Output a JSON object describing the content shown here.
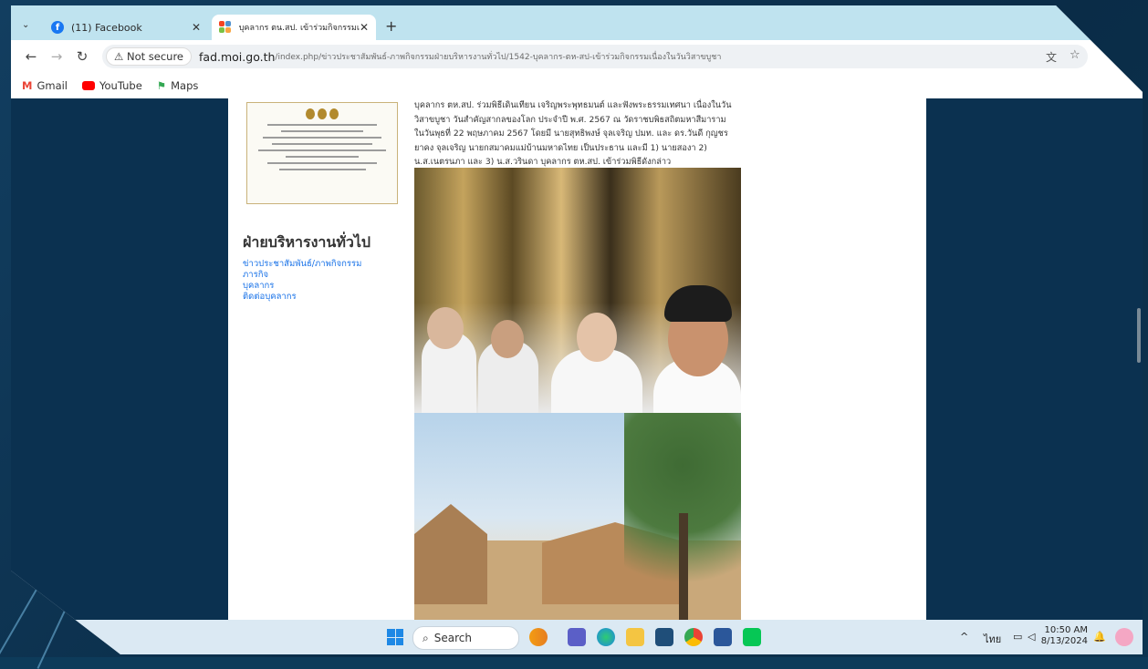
{
  "tabs": [
    {
      "title": "(11) Facebook"
    },
    {
      "title": "บุคลากร ตน.สป. เข้าร่วมกิจกรรมเนื่อ"
    }
  ],
  "new_tab": "+",
  "address": {
    "security": "Not secure",
    "host": "fad.moi.go.th",
    "path": "/index.php/ข่าวประชาสัมพันธ์-ภาพกิจกรรมฝ่ายบริหารงานทั่วไป/1542-บุคลากร-ตห-สป-เข้าร่วมกิจกรรมเนื่องในวันวิสาขบูชา"
  },
  "bookmarks": [
    {
      "label": "Gmail"
    },
    {
      "label": "YouTube"
    },
    {
      "label": "Maps"
    }
  ],
  "sidebar": {
    "title": "ฝ่ายบริหารงานทั่วไป",
    "links": [
      "ข่าวประชาสัมพันธ์/ภาพกิจกรรม",
      "ภารกิจ",
      "บุคลากร",
      "ติดต่อบุคลากร"
    ]
  },
  "article": {
    "lines": [
      "บุคลากร ตห.สป. ร่วมพิธีเดินเทียน เจริญพระพุทธมนต์ และฟังพระธรรมเทศนา เนื่องในวัน",
      "วิสาขบูชา วันสำคัญสากลของโลก ประจำปี พ.ศ. 2567 ณ วัดราชบพิธสถิตมหาสีมาราม",
      "ในวันพุธที่ 22 พฤษภาคม 2567 โดยมี นายสุทธิพงษ์ จุลเจริญ ปมท. และ ดร.วันดี กุญชร",
      "ยาคง จุลเจริญ นายกสมาคมแม่บ้านมหาดไทย เป็นประธาน และมี 1) นายสองา 2)",
      "น.ส.เนตรนภา และ 3) น.ส.วรินดา บุคลากร ตห.สป. เข้าร่วมพิธีดังกล่าว"
    ]
  },
  "taskbar": {
    "search": "Search",
    "time": "10:50 AM",
    "date": "8/13/2024",
    "lang": "ไทย"
  }
}
